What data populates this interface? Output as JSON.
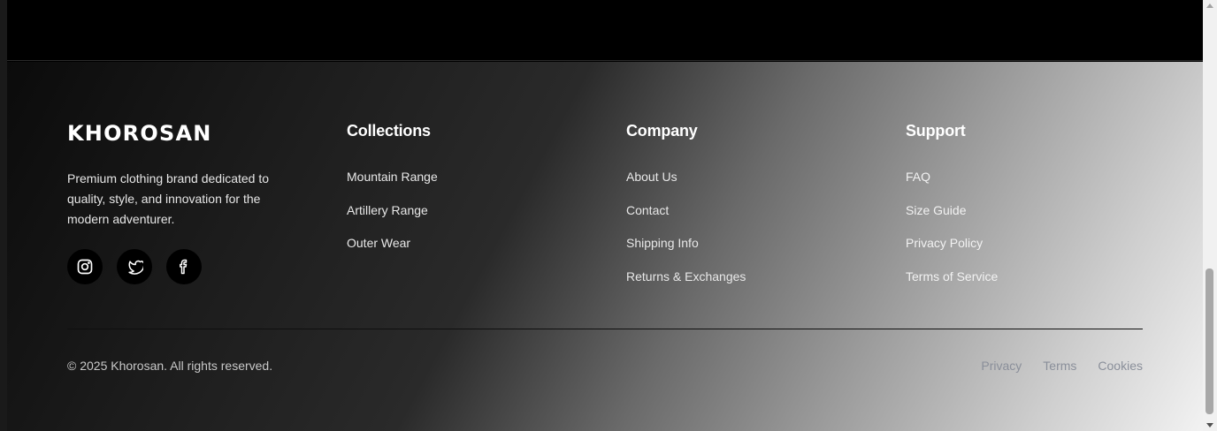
{
  "brand": {
    "name": "KHOROSAN",
    "description": "Premium clothing brand dedicated to quality, style, and innovation for the modern adventurer.",
    "socials": [
      {
        "icon": "instagram-icon"
      },
      {
        "icon": "twitter-icon"
      },
      {
        "icon": "facebook-icon"
      }
    ]
  },
  "columns": {
    "collections": {
      "heading": "Collections",
      "links": [
        "Mountain Range",
        "Artillery Range",
        "Outer Wear"
      ]
    },
    "company": {
      "heading": "Company",
      "links": [
        "About Us",
        "Contact",
        "Shipping Info",
        "Returns & Exchanges"
      ]
    },
    "support": {
      "heading": "Support",
      "links": [
        "FAQ",
        "Size Guide",
        "Privacy Policy",
        "Terms of Service"
      ]
    }
  },
  "bottom": {
    "copyright": "© 2025 Khorosan. All rights reserved.",
    "legal_links": [
      "Privacy",
      "Terms",
      "Cookies"
    ]
  },
  "colors": {
    "background": "#000000",
    "heading": "#ffffff",
    "link": "#e8e8e8",
    "legal_link": "#8a8f9a"
  }
}
